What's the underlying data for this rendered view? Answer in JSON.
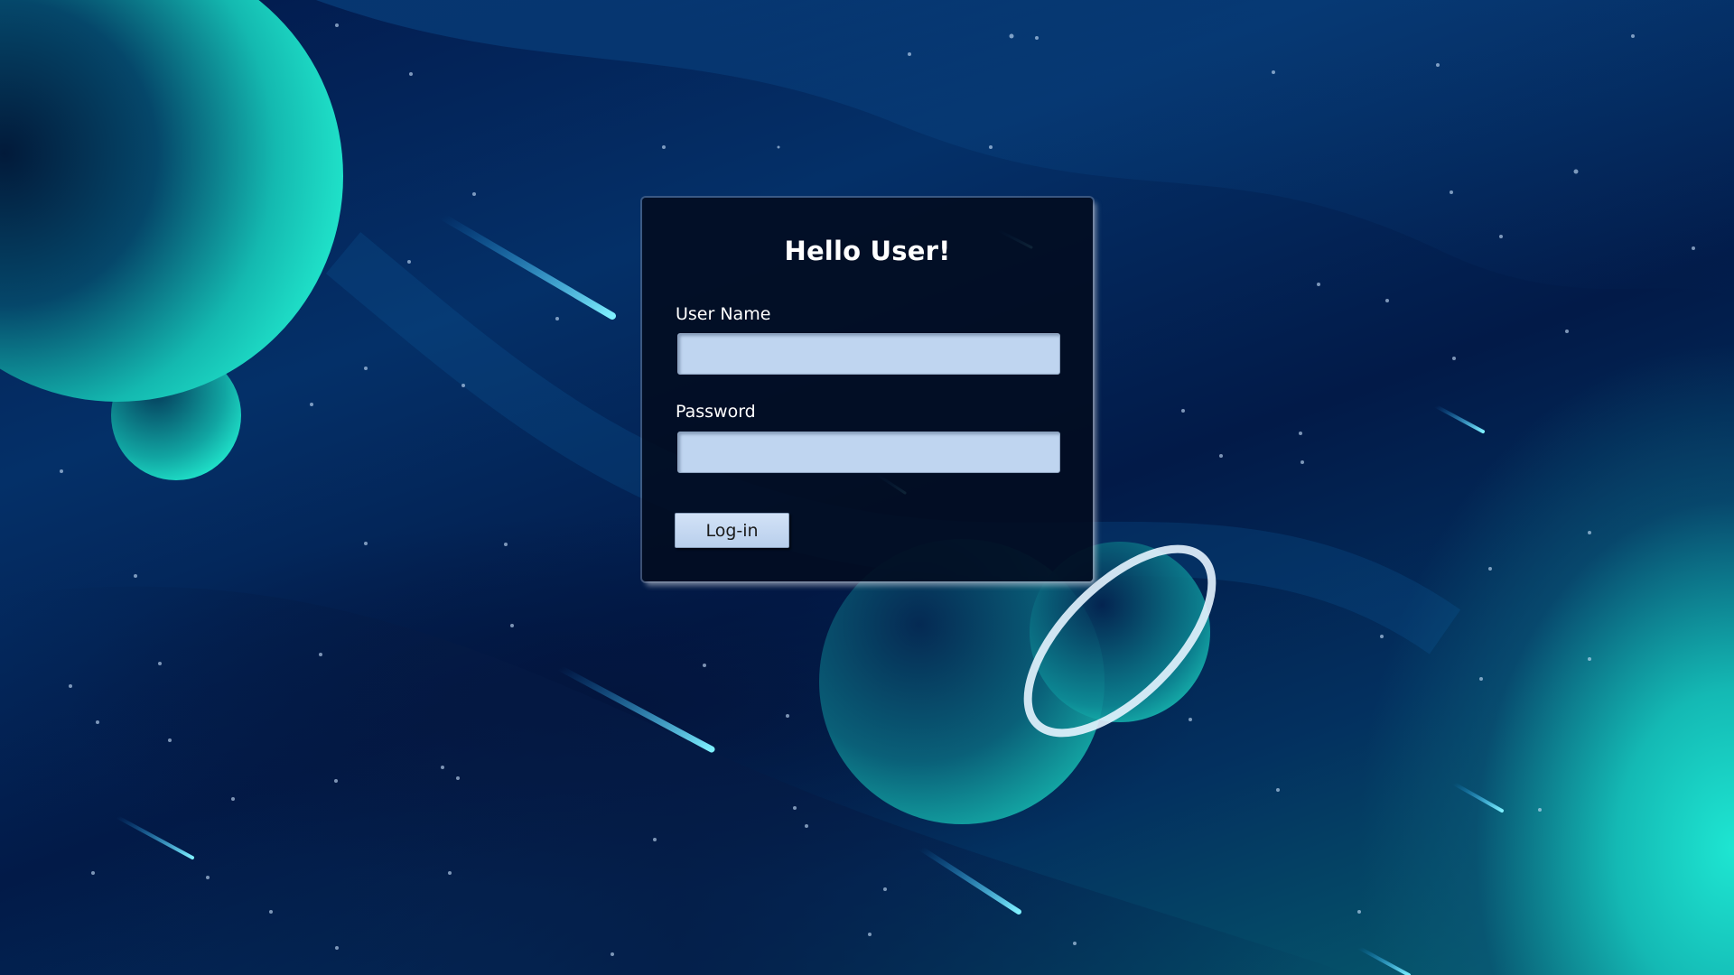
{
  "login": {
    "title": "Hello User!",
    "username_label": "User Name",
    "username_value": "",
    "password_label": "Password",
    "password_value": "",
    "submit_label": "Log-in"
  },
  "colors": {
    "panel_background": "#020c20",
    "input_fill": "#bfd5f0",
    "button_fill": "#c6d9f2",
    "accent_teal": "#1ee6d2",
    "deep_blue": "#02184a"
  },
  "background": {
    "theme": "space scene with teal planets, ringed planet and shooting stars"
  }
}
